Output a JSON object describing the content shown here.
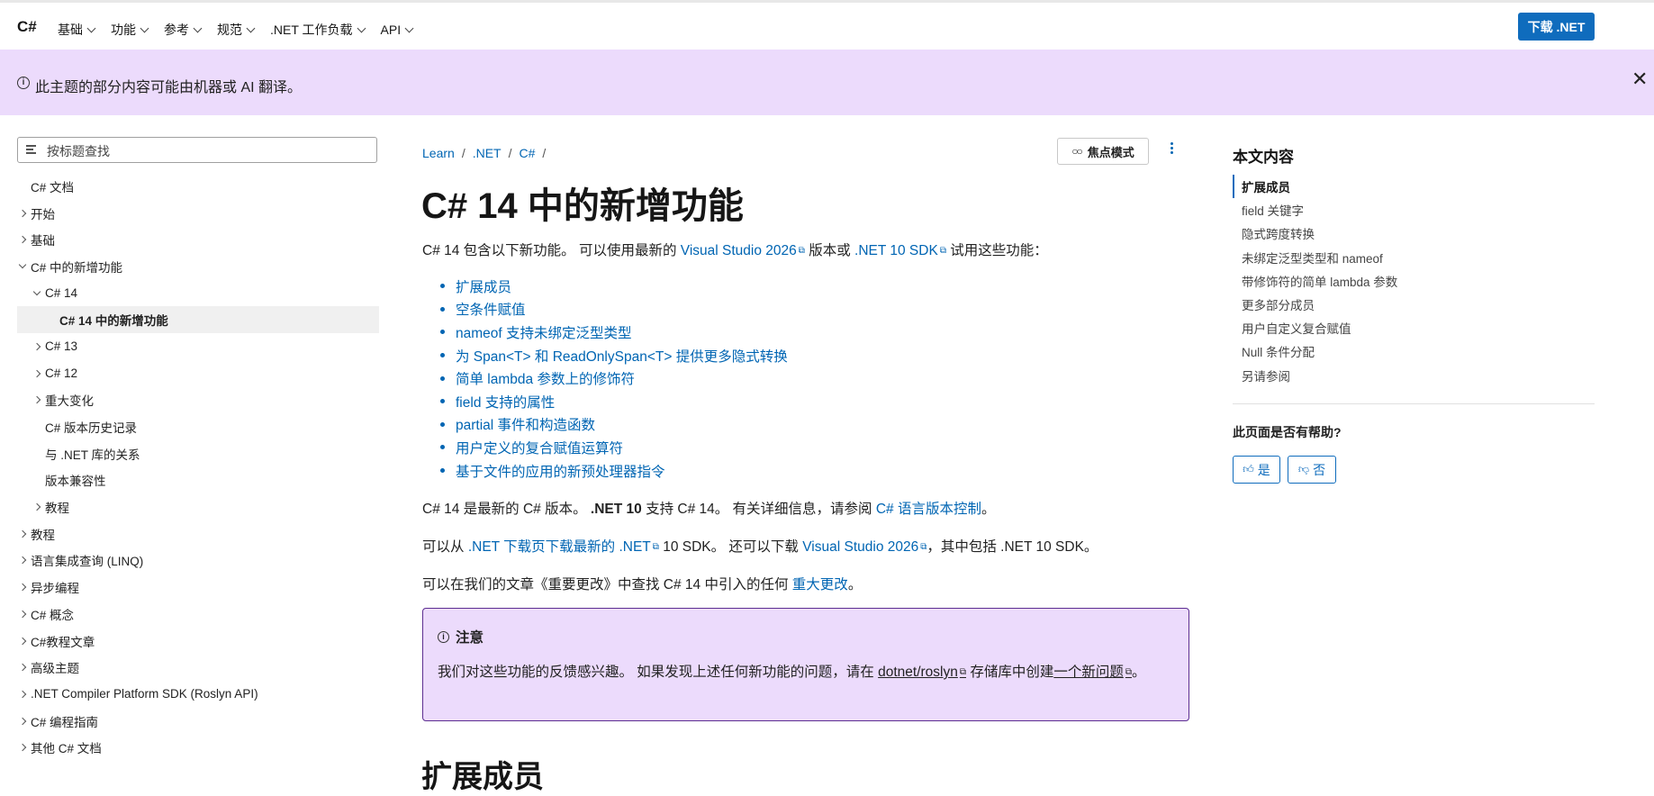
{
  "header": {
    "brand": "C#",
    "nav": [
      "基础",
      "功能",
      "参考",
      "规范",
      ".NET 工作负载",
      "API"
    ],
    "download_label": "下载 .NET"
  },
  "banner": {
    "text": "此主题的部分内容可能由机器或 AI 翻译。",
    "close": "✕"
  },
  "sidebar": {
    "filter_placeholder": "按标题查找",
    "items": [
      {
        "label": "C# 文档",
        "level": 0,
        "chevron": "none"
      },
      {
        "label": "开始",
        "level": 0,
        "chevron": "right"
      },
      {
        "label": "基础",
        "level": 0,
        "chevron": "right"
      },
      {
        "label": "C# 中的新增功能",
        "level": 0,
        "chevron": "down"
      },
      {
        "label": "C# 14",
        "level": 1,
        "chevron": "down"
      },
      {
        "label": "C# 14 中的新增功能",
        "level": 2,
        "chevron": "none",
        "selected": true
      },
      {
        "label": "C# 13",
        "level": 1,
        "chevron": "right"
      },
      {
        "label": "C# 12",
        "level": 1,
        "chevron": "right"
      },
      {
        "label": "重大变化",
        "level": 1,
        "chevron": "right"
      },
      {
        "label": "C# 版本历史记录",
        "level": 1,
        "chevron": "none"
      },
      {
        "label": "与 .NET 库的关系",
        "level": 1,
        "chevron": "none"
      },
      {
        "label": "版本兼容性",
        "level": 1,
        "chevron": "none"
      },
      {
        "label": "教程",
        "level": 1,
        "chevron": "right"
      },
      {
        "label": "教程",
        "level": 0,
        "chevron": "right"
      },
      {
        "label": "语言集成查询 (LINQ)",
        "level": 0,
        "chevron": "right"
      },
      {
        "label": "异步编程",
        "level": 0,
        "chevron": "right"
      },
      {
        "label": "C# 概念",
        "level": 0,
        "chevron": "right"
      },
      {
        "label": "C#教程文章",
        "level": 0,
        "chevron": "right"
      },
      {
        "label": "高级主题",
        "level": 0,
        "chevron": "right"
      },
      {
        "label": ".NET Compiler Platform SDK (Roslyn API)",
        "level": 0,
        "chevron": "right"
      },
      {
        "label": "C# 编程指南",
        "level": 0,
        "chevron": "right"
      },
      {
        "label": "其他 C# 文档",
        "level": 0,
        "chevron": "right"
      }
    ]
  },
  "breadcrumb": [
    "Learn",
    ".NET",
    "C#"
  ],
  "breadcrumb_sep": "/",
  "focus_mode_label": "焦点模式",
  "main": {
    "title": "C# 14 中的新增功能",
    "intro": {
      "t1": "C# 14 包含以下新功能。 可以使用最新的 ",
      "l1": "Visual Studio 2026",
      "t2": " 版本或 ",
      "l2": ".NET 10 SDK",
      "t3": " 试用这些功能："
    },
    "features": [
      "扩展成员",
      "空条件赋值",
      "nameof 支持未绑定泛型类型",
      "为 Span<T> 和 ReadOnlySpan<T> 提供更多隐式转换",
      "简单 lambda 参数上的修饰符",
      "field 支持的属性",
      "partial 事件和构造函数",
      "用户定义的复合赋值运算符",
      "基于文件的应用的新预处理器指令"
    ],
    "p2": {
      "t1": "C# 14 是最新的 C# 版本。 ",
      "b1": ".NET 10",
      "t2": " 支持 C# 14。 有关详细信息，请参阅 ",
      "l1": "C# 语言版本控制",
      "t3": "。"
    },
    "p3": {
      "t1": "可以从 ",
      "l1": ".NET 下载页下载最新的 .NET",
      "t2": " 10 SDK。 还可以下载 ",
      "l2": "Visual Studio 2026",
      "t3": "，其中包括 .NET 10 SDK。"
    },
    "p4": {
      "t1": "可以在我们的文章《重要更改》中查找 C# 14 中引入的任何 ",
      "l1": "重大更改",
      "t2": "。"
    },
    "note": {
      "heading": "注意",
      "t1": "我们对这些功能的反馈感兴趣。 如果发现上述任何新功能的问题，请在 ",
      "l1": "dotnet/roslyn",
      "t2": " 存储库中创建",
      "l2": "一个新问题",
      "t3": "。"
    },
    "section_heading": "扩展成员"
  },
  "rail": {
    "title": "本文内容",
    "items": [
      "扩展成员",
      "field 关键字",
      "隐式跨度转换",
      "未绑定泛型类型和 nameof",
      "带修饰符的简单 lambda 参数",
      "更多部分成员",
      "用户自定义复合赋值",
      "Null 条件分配",
      "另请参阅"
    ],
    "helpful_label": "此页面是否有帮助?",
    "yes_label": "是",
    "no_label": "否"
  },
  "colors": {
    "accent": "#0f6cbd",
    "banner_bg": "#ecdbfc",
    "note_border": "#5c2d91"
  }
}
